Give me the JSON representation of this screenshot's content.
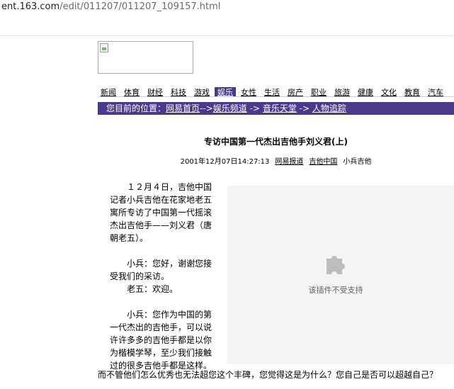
{
  "url": {
    "host": "ent.163.com",
    "path": "/edit/011207/011207_109157.html"
  },
  "nav": {
    "items": [
      "新闻",
      "体育",
      "财经",
      "科技",
      "游戏",
      "娱乐",
      "女性",
      "生活",
      "房产",
      "职业",
      "旅游",
      "健康",
      "文化",
      "教育",
      "汽车"
    ],
    "active": "娱乐"
  },
  "location": {
    "prefix": "您目前的位置：",
    "crumbs": [
      "网易首页",
      "娱乐频道",
      "音乐天堂",
      "人物追踪"
    ],
    "separators": [
      "-->",
      "->",
      "->"
    ]
  },
  "article": {
    "title": "专访中国第一代杰出吉他手刘义君(上)",
    "datetime": "2001年12月07日14:27:13",
    "sources": [
      "网易报道",
      "吉他中国"
    ],
    "author": "小兵吉他",
    "intro": "　　１２月４日，吉他中国记者小兵吉他在花家地老五寓所专访了中国第一代摇滚杰出吉他手——刘义君（唐朝老五）。",
    "q1": "　　小兵：您好，谢谢您接受我们的采访。",
    "a1": "　　老五：欢迎。",
    "q2_start": "　　小兵：您作为中国的第一代杰出的吉他手，可以说许许多多的吉他手都是以你为楷模学琴，至少我们接触过的很多吉他手都是这样。",
    "q2_rest": "而不管他们怎么优秀也无法超您这个丰碑，您觉得这是为什么？您自己是否可以超越自己？"
  },
  "plugin": {
    "message": "该插件不受支持",
    "icon": "puzzle-icon"
  }
}
